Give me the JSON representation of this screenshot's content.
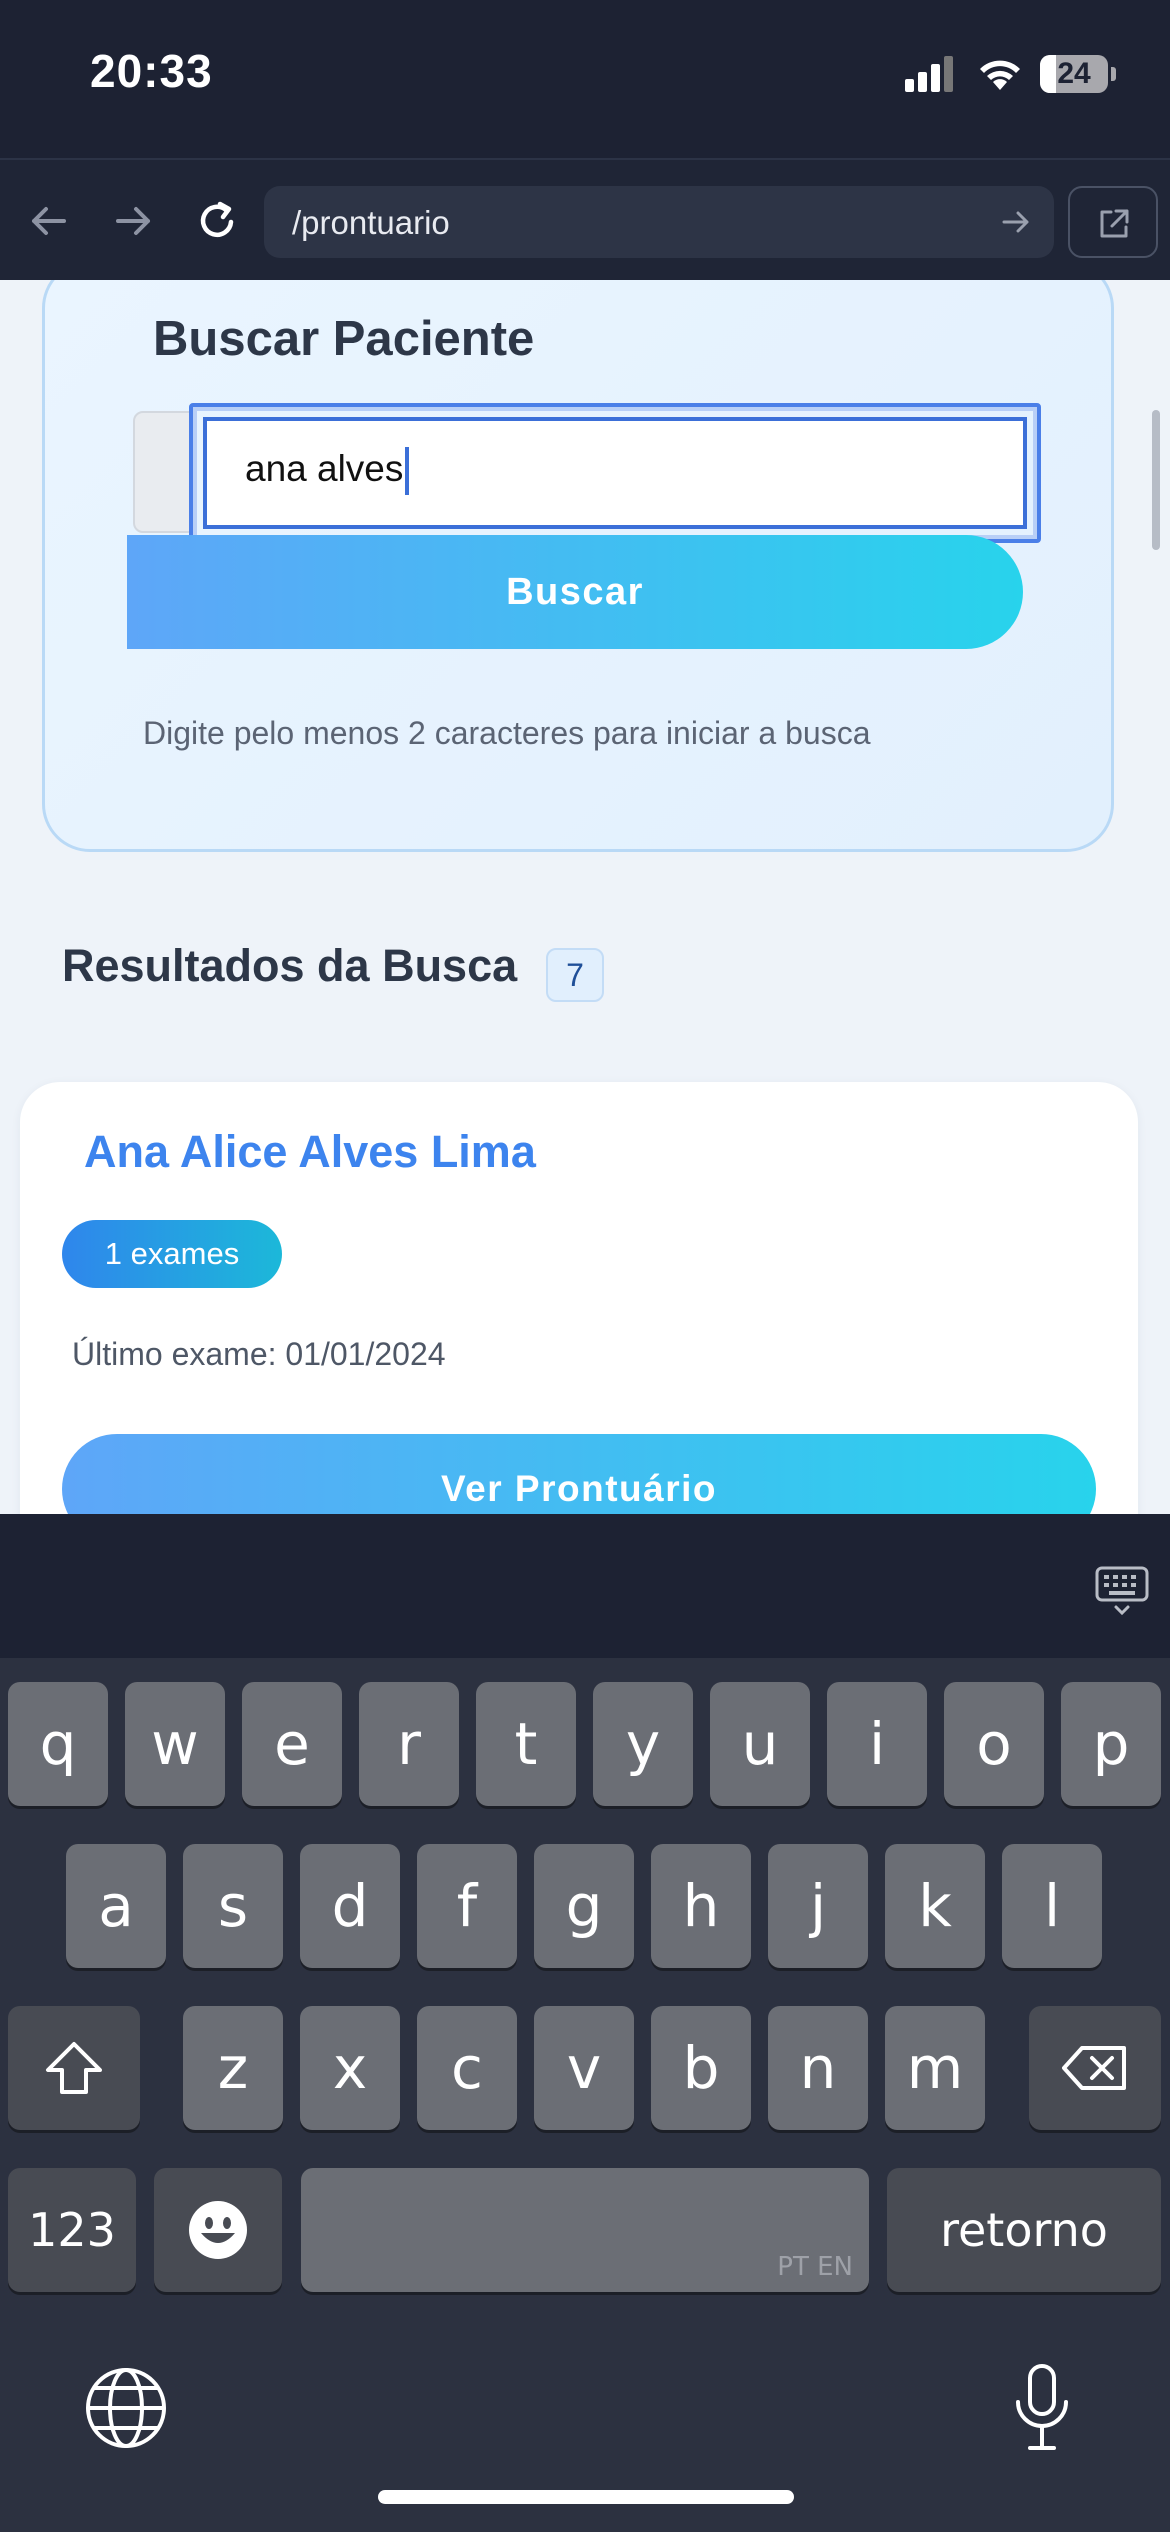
{
  "status_bar": {
    "time": "20:33",
    "battery": "24"
  },
  "browser": {
    "url": "/prontuario"
  },
  "search": {
    "title": "Buscar Paciente",
    "input_value": "ana alves",
    "button_label": "Buscar",
    "hint": "Digite pelo menos 2 caracteres para iniciar a busca"
  },
  "results": {
    "title": "Resultados da Busca",
    "count": "7",
    "items": [
      {
        "name": "Ana Alice Alves Lima",
        "exams_badge": "1 exames",
        "last_exam": "Último exame: 01/01/2024",
        "button_label": "Ver Prontuário"
      }
    ]
  },
  "keyboard": {
    "row1": [
      "q",
      "w",
      "e",
      "r",
      "t",
      "y",
      "u",
      "i",
      "o",
      "p"
    ],
    "row2": [
      "a",
      "s",
      "d",
      "f",
      "g",
      "h",
      "j",
      "k",
      "l"
    ],
    "row3": [
      "z",
      "x",
      "c",
      "v",
      "b",
      "n",
      "m"
    ],
    "numbers_label": "123",
    "space_lang": "PT EN",
    "return_label": "retorno"
  }
}
